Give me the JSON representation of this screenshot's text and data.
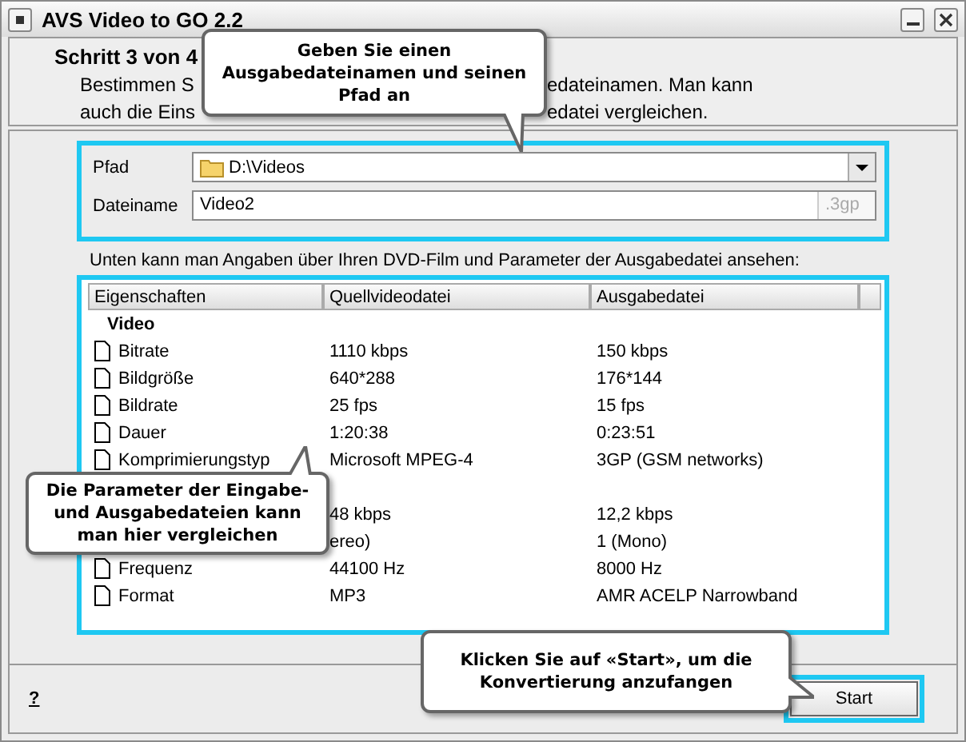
{
  "window": {
    "title": "AVS Video to GO 2.2"
  },
  "header": {
    "step": "Schritt 3 von 4",
    "lines": [
      {
        "left": "Bestimmen S",
        "right": "edateinamen. Man kann"
      },
      {
        "left": "auch die Eins",
        "right": "edatei vergleichen."
      }
    ]
  },
  "form": {
    "path_label": "Pfad",
    "path_value": "D:\\Videos",
    "name_label": "Dateiname",
    "name_value": "Video2",
    "extension": ".3gp"
  },
  "info_text": "Unten kann man Angaben über Ihren DVD-Film und Parameter der Ausgabedatei ansehen:",
  "table": {
    "columns": [
      "Eigenschaften",
      "Quellvideodatei",
      "Ausgabedatei"
    ],
    "rows": [
      {
        "kind": "group",
        "label": "Video"
      },
      {
        "kind": "item",
        "property": "Bitrate",
        "source": "1110 kbps",
        "output": "150 kbps"
      },
      {
        "kind": "item",
        "property": "Bildgröße",
        "source": "640*288",
        "output": "176*144"
      },
      {
        "kind": "item",
        "property": "Bildrate",
        "source": "25 fps",
        "output": "15 fps"
      },
      {
        "kind": "item",
        "property": "Dauer",
        "source": "1:20:38",
        "output": "0:23:51"
      },
      {
        "kind": "item",
        "property": "Komprimierungstyp",
        "source": "Microsoft MPEG-4",
        "output": "3GP (GSM networks)"
      },
      {
        "kind": "blank"
      },
      {
        "kind": "item",
        "source": "48 kbps",
        "output": "12,2 kbps"
      },
      {
        "kind": "item",
        "source": "ereo)",
        "output": "1 (Mono)"
      },
      {
        "kind": "item",
        "property": "Frequenz",
        "source": "44100 Hz",
        "output": "8000 Hz"
      },
      {
        "kind": "item",
        "property": "Format",
        "source": "MP3",
        "output": "AMR ACELP Narrowband"
      }
    ]
  },
  "footer": {
    "help": "?",
    "start": "Start"
  },
  "callouts": [
    {
      "kind": "top",
      "text": "Geben Sie einen Ausgabedateinamen und seinen Pfad an"
    },
    {
      "kind": "left",
      "text": "Die Parameter der Eingabe- und Ausgabedateien kann man hier vergleichen"
    },
    {
      "kind": "bottom",
      "text": "Klicken Sie auf «Start», um die Konvertierung anzufangen"
    }
  ]
}
